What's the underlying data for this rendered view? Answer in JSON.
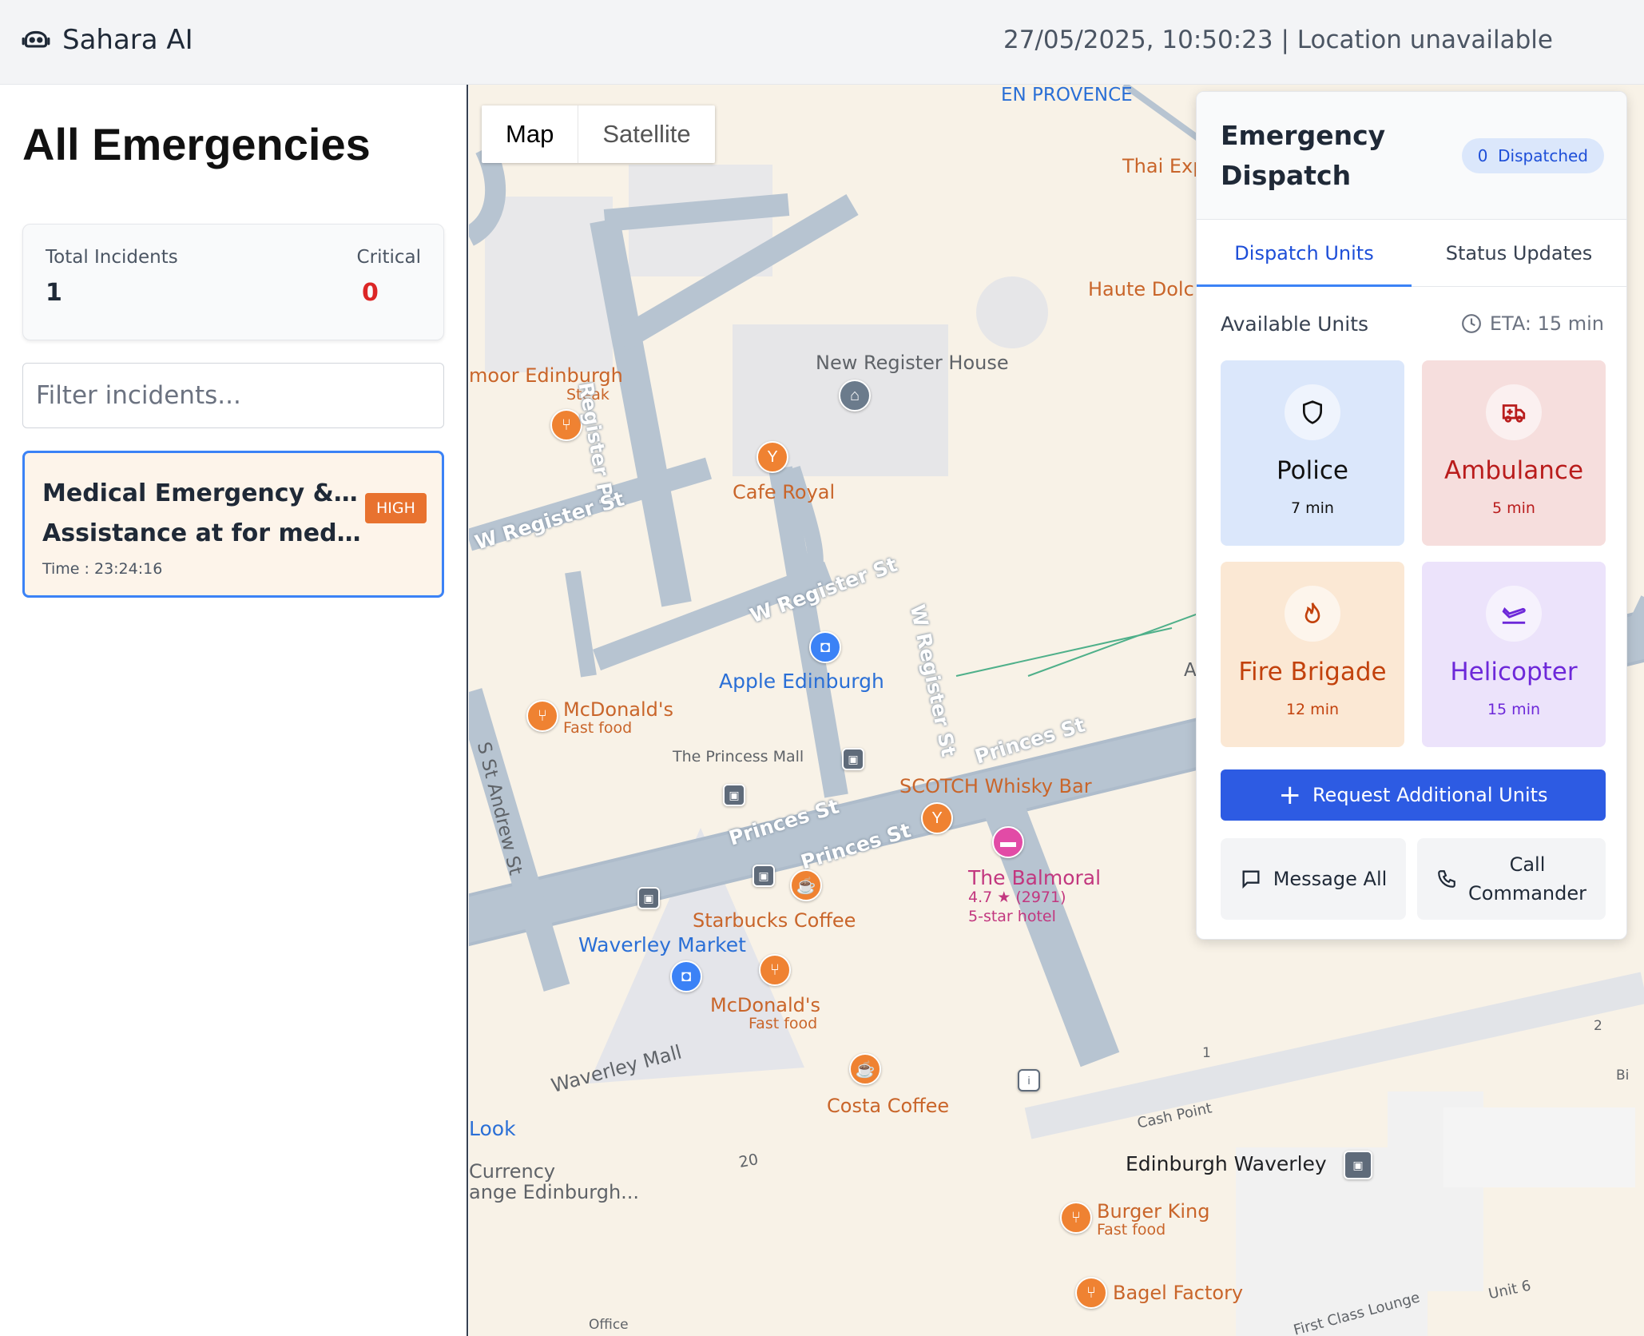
{
  "header": {
    "brand": "Sahara AI",
    "meta": "27/05/2025, 10:50:23 | Location unavailable"
  },
  "sidebar": {
    "title": "All Emergencies",
    "stats": {
      "total_label": "Total Incidents",
      "total_value": "1",
      "critical_label": "Critical",
      "critical_value": "0"
    },
    "filter_placeholder": "Filter incidents...",
    "incidents": [
      {
        "title_line1": "Medical Emergency & Food",
        "title_line2": "Assistance at for medical...",
        "severity": "HIGH",
        "time": "Time : 23:24:16"
      }
    ]
  },
  "map": {
    "type_controls": {
      "map": "Map",
      "satellite": "Satellite"
    },
    "labels": {
      "en_provence": "EN PROVENCE",
      "thai": "Thai Exp",
      "haute": "Haute Dolci",
      "new_register_house": "New Register House",
      "moor": "moor Edinburgh",
      "steak": "Steak",
      "register_pl": "Register Pl",
      "w_register_st_left": "W Register St",
      "cafe_royal": "Cafe Royal",
      "w_register_st_mid": "W Register St",
      "w_register_st_vert": "W Register St",
      "apple": "Apple Edinburgh",
      "mcdonalds_1": "McDonald's",
      "fast_food_1": "Fast food",
      "princess_mall": "The Princess Mall",
      "princes_st_1": "Princes St",
      "princes_st_2": "Princes St",
      "princes_st_3": "Princes St",
      "s_st_andrew": "S St Andrew St",
      "scotch": "SCOTCH Whisky Bar",
      "balmoral": "The Balmoral",
      "balmoral_rating": "4.7 ★ (2971)",
      "balmoral_type": "5-star hotel",
      "starbucks": "Starbucks Coffee",
      "waverley_market": "Waverley Market",
      "mcdonalds_2": "McDonald's",
      "fast_food_2": "Fast food",
      "waverley_mall": "Waverley Mall",
      "costa": "Costa Coffee",
      "look": "Look",
      "currency_1": "Currency",
      "currency_2": "ange Edinburgh...",
      "num_20": "20",
      "cash_point": "Cash Point",
      "edinburgh_waverley": "Edinburgh Waverley",
      "burger_king": "Burger King",
      "fast_food_3": "Fast food",
      "bagel": "Bagel Factory",
      "first_class": "First Class Lounge",
      "unit_6": "Unit 6",
      "num_1": "1",
      "num_2": "2",
      "bi": "Bi",
      "office": "Office",
      "a_road": "A"
    }
  },
  "dispatch": {
    "title": "Emergency Dispatch",
    "dispatched_count": "0",
    "dispatched_label": "Dispatched",
    "tabs": [
      "Dispatch Units",
      "Status Updates"
    ],
    "available_label": "Available Units",
    "eta": "ETA: 15 min",
    "units": [
      {
        "name": "Police",
        "time": "7 min",
        "icon": "shield-icon"
      },
      {
        "name": "Ambulance",
        "time": "5 min",
        "icon": "ambulance-icon"
      },
      {
        "name": "Fire Brigade",
        "time": "12 min",
        "icon": "flame-icon"
      },
      {
        "name": "Helicopter",
        "time": "15 min",
        "icon": "plane-icon"
      }
    ],
    "request_label": "Request Additional Units",
    "message_all": "Message All",
    "call_commander_line1": "Call",
    "call_commander_line2": "Commander"
  }
}
